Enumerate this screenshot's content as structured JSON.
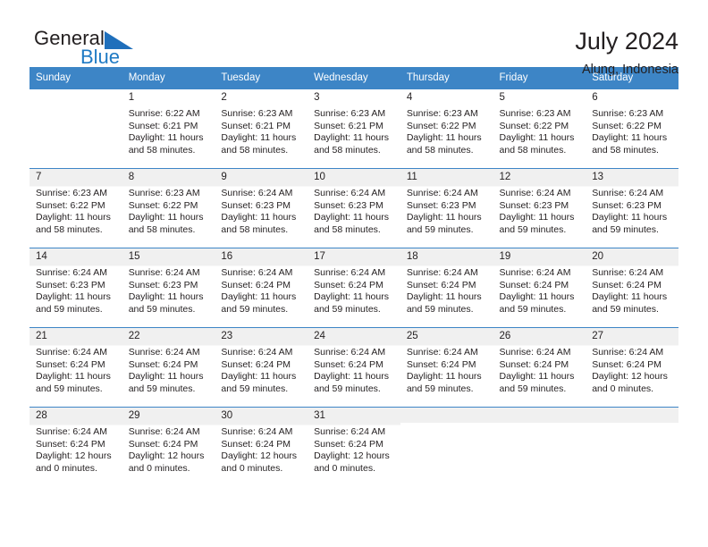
{
  "brand": {
    "name_part1": "General",
    "name_part2": "Blue",
    "logo_icon": "triangle-logo-icon"
  },
  "header": {
    "title": "July 2024",
    "location": "Alung, Indonesia"
  },
  "calendar": {
    "weekday_headers": [
      "Sunday",
      "Monday",
      "Tuesday",
      "Wednesday",
      "Thursday",
      "Friday",
      "Saturday"
    ],
    "accent_color": "#3d85c6",
    "shade_color": "#f0f0f0",
    "weeks": [
      {
        "shaded": false,
        "days": [
          {
            "num": "",
            "sunrise": "",
            "sunset": "",
            "daylight1": "",
            "daylight2": ""
          },
          {
            "num": "1",
            "sunrise": "Sunrise: 6:22 AM",
            "sunset": "Sunset: 6:21 PM",
            "daylight1": "Daylight: 11 hours",
            "daylight2": "and 58 minutes."
          },
          {
            "num": "2",
            "sunrise": "Sunrise: 6:23 AM",
            "sunset": "Sunset: 6:21 PM",
            "daylight1": "Daylight: 11 hours",
            "daylight2": "and 58 minutes."
          },
          {
            "num": "3",
            "sunrise": "Sunrise: 6:23 AM",
            "sunset": "Sunset: 6:21 PM",
            "daylight1": "Daylight: 11 hours",
            "daylight2": "and 58 minutes."
          },
          {
            "num": "4",
            "sunrise": "Sunrise: 6:23 AM",
            "sunset": "Sunset: 6:22 PM",
            "daylight1": "Daylight: 11 hours",
            "daylight2": "and 58 minutes."
          },
          {
            "num": "5",
            "sunrise": "Sunrise: 6:23 AM",
            "sunset": "Sunset: 6:22 PM",
            "daylight1": "Daylight: 11 hours",
            "daylight2": "and 58 minutes."
          },
          {
            "num": "6",
            "sunrise": "Sunrise: 6:23 AM",
            "sunset": "Sunset: 6:22 PM",
            "daylight1": "Daylight: 11 hours",
            "daylight2": "and 58 minutes."
          }
        ]
      },
      {
        "shaded": true,
        "days": [
          {
            "num": "7",
            "sunrise": "Sunrise: 6:23 AM",
            "sunset": "Sunset: 6:22 PM",
            "daylight1": "Daylight: 11 hours",
            "daylight2": "and 58 minutes."
          },
          {
            "num": "8",
            "sunrise": "Sunrise: 6:23 AM",
            "sunset": "Sunset: 6:22 PM",
            "daylight1": "Daylight: 11 hours",
            "daylight2": "and 58 minutes."
          },
          {
            "num": "9",
            "sunrise": "Sunrise: 6:24 AM",
            "sunset": "Sunset: 6:23 PM",
            "daylight1": "Daylight: 11 hours",
            "daylight2": "and 58 minutes."
          },
          {
            "num": "10",
            "sunrise": "Sunrise: 6:24 AM",
            "sunset": "Sunset: 6:23 PM",
            "daylight1": "Daylight: 11 hours",
            "daylight2": "and 58 minutes."
          },
          {
            "num": "11",
            "sunrise": "Sunrise: 6:24 AM",
            "sunset": "Sunset: 6:23 PM",
            "daylight1": "Daylight: 11 hours",
            "daylight2": "and 59 minutes."
          },
          {
            "num": "12",
            "sunrise": "Sunrise: 6:24 AM",
            "sunset": "Sunset: 6:23 PM",
            "daylight1": "Daylight: 11 hours",
            "daylight2": "and 59 minutes."
          },
          {
            "num": "13",
            "sunrise": "Sunrise: 6:24 AM",
            "sunset": "Sunset: 6:23 PM",
            "daylight1": "Daylight: 11 hours",
            "daylight2": "and 59 minutes."
          }
        ]
      },
      {
        "shaded": true,
        "days": [
          {
            "num": "14",
            "sunrise": "Sunrise: 6:24 AM",
            "sunset": "Sunset: 6:23 PM",
            "daylight1": "Daylight: 11 hours",
            "daylight2": "and 59 minutes."
          },
          {
            "num": "15",
            "sunrise": "Sunrise: 6:24 AM",
            "sunset": "Sunset: 6:23 PM",
            "daylight1": "Daylight: 11 hours",
            "daylight2": "and 59 minutes."
          },
          {
            "num": "16",
            "sunrise": "Sunrise: 6:24 AM",
            "sunset": "Sunset: 6:24 PM",
            "daylight1": "Daylight: 11 hours",
            "daylight2": "and 59 minutes."
          },
          {
            "num": "17",
            "sunrise": "Sunrise: 6:24 AM",
            "sunset": "Sunset: 6:24 PM",
            "daylight1": "Daylight: 11 hours",
            "daylight2": "and 59 minutes."
          },
          {
            "num": "18",
            "sunrise": "Sunrise: 6:24 AM",
            "sunset": "Sunset: 6:24 PM",
            "daylight1": "Daylight: 11 hours",
            "daylight2": "and 59 minutes."
          },
          {
            "num": "19",
            "sunrise": "Sunrise: 6:24 AM",
            "sunset": "Sunset: 6:24 PM",
            "daylight1": "Daylight: 11 hours",
            "daylight2": "and 59 minutes."
          },
          {
            "num": "20",
            "sunrise": "Sunrise: 6:24 AM",
            "sunset": "Sunset: 6:24 PM",
            "daylight1": "Daylight: 11 hours",
            "daylight2": "and 59 minutes."
          }
        ]
      },
      {
        "shaded": true,
        "days": [
          {
            "num": "21",
            "sunrise": "Sunrise: 6:24 AM",
            "sunset": "Sunset: 6:24 PM",
            "daylight1": "Daylight: 11 hours",
            "daylight2": "and 59 minutes."
          },
          {
            "num": "22",
            "sunrise": "Sunrise: 6:24 AM",
            "sunset": "Sunset: 6:24 PM",
            "daylight1": "Daylight: 11 hours",
            "daylight2": "and 59 minutes."
          },
          {
            "num": "23",
            "sunrise": "Sunrise: 6:24 AM",
            "sunset": "Sunset: 6:24 PM",
            "daylight1": "Daylight: 11 hours",
            "daylight2": "and 59 minutes."
          },
          {
            "num": "24",
            "sunrise": "Sunrise: 6:24 AM",
            "sunset": "Sunset: 6:24 PM",
            "daylight1": "Daylight: 11 hours",
            "daylight2": "and 59 minutes."
          },
          {
            "num": "25",
            "sunrise": "Sunrise: 6:24 AM",
            "sunset": "Sunset: 6:24 PM",
            "daylight1": "Daylight: 11 hours",
            "daylight2": "and 59 minutes."
          },
          {
            "num": "26",
            "sunrise": "Sunrise: 6:24 AM",
            "sunset": "Sunset: 6:24 PM",
            "daylight1": "Daylight: 11 hours",
            "daylight2": "and 59 minutes."
          },
          {
            "num": "27",
            "sunrise": "Sunrise: 6:24 AM",
            "sunset": "Sunset: 6:24 PM",
            "daylight1": "Daylight: 12 hours",
            "daylight2": "and 0 minutes."
          }
        ]
      },
      {
        "shaded": true,
        "days": [
          {
            "num": "28",
            "sunrise": "Sunrise: 6:24 AM",
            "sunset": "Sunset: 6:24 PM",
            "daylight1": "Daylight: 12 hours",
            "daylight2": "and 0 minutes."
          },
          {
            "num": "29",
            "sunrise": "Sunrise: 6:24 AM",
            "sunset": "Sunset: 6:24 PM",
            "daylight1": "Daylight: 12 hours",
            "daylight2": "and 0 minutes."
          },
          {
            "num": "30",
            "sunrise": "Sunrise: 6:24 AM",
            "sunset": "Sunset: 6:24 PM",
            "daylight1": "Daylight: 12 hours",
            "daylight2": "and 0 minutes."
          },
          {
            "num": "31",
            "sunrise": "Sunrise: 6:24 AM",
            "sunset": "Sunset: 6:24 PM",
            "daylight1": "Daylight: 12 hours",
            "daylight2": "and 0 minutes."
          },
          {
            "num": "",
            "sunrise": "",
            "sunset": "",
            "daylight1": "",
            "daylight2": ""
          },
          {
            "num": "",
            "sunrise": "",
            "sunset": "",
            "daylight1": "",
            "daylight2": ""
          },
          {
            "num": "",
            "sunrise": "",
            "sunset": "",
            "daylight1": "",
            "daylight2": ""
          }
        ]
      }
    ]
  }
}
